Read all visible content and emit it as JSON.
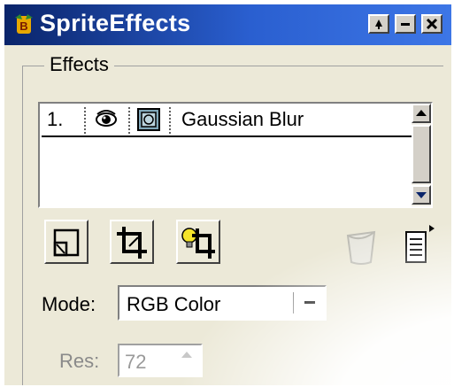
{
  "window": {
    "title": "SpriteEffects",
    "icons": {
      "app": "app-logo-icon",
      "restore": "pin-icon",
      "minimize": "minimize-icon",
      "close": "close-icon"
    }
  },
  "effects_group": {
    "label": "Effects",
    "items": [
      {
        "number": "1.",
        "visibility_icon": "eye-icon",
        "type_icon": "filter-icon",
        "name": "Gaussian Blur"
      }
    ]
  },
  "toolbar": {
    "buttons": [
      {
        "icon": "new-effect-icon"
      },
      {
        "icon": "crop-icon"
      },
      {
        "icon": "lit-crop-icon"
      }
    ],
    "trash_icon": "trash-icon",
    "menu_icon": "panel-menu-icon"
  },
  "mode": {
    "label": "Mode:",
    "value": "RGB Color"
  },
  "res": {
    "label": "Res:",
    "value": "72"
  }
}
